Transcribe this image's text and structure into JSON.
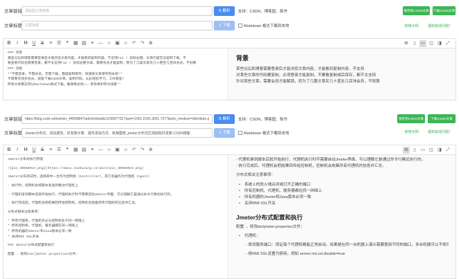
{
  "common": {
    "url_label": "文章链接:",
    "title_label": "文章标题:",
    "parse_button": "⇅ 解析",
    "download_button": "⇩ 下载",
    "support_text": "支持：CSDN、博客园、简书",
    "markdown_text": "Markdown 格式下载到本地",
    "save_csdn": "保存到CSDN文章",
    "download_csdn": "下载CSDN文章",
    "link_example": "使用示例",
    "link_qa": "遇到其他问题？"
  },
  "top": {
    "url_placeholder": "请粘贴文章链接",
    "title_placeholder": "文章标题",
    "source_lines": [
      "### 背景",
      "某些论坛和博客需要登录后才能浏览文章内容，才能看到复制内容。不支持F12 / 鼠标右键，文章内容无法复制下载，不",
      "要查看代码也需要登录，都不太支持F12 / 鼠标右键文章，需要会员才能复制，而为了几篇文章花几十甚至几百块会员，不划算",
      "### 功能",
      "**不需登录，不需会员，无需下载，直接复制保存，快速将文章保存到本地**",
      "不需要花钱买会员，就能下载CSDN文章，复制代码，从此轻松学习，工作摸鱼！",
      "所有文章都支持以Markdown格式下载，确保格式统一，有效保护原文排版**"
    ],
    "preview": {
      "heading": "背景",
      "paragraph_lines": [
        "某些论坛和博客需要登录后才能浏览文章内容，才能看到复制内容，不支持",
        "对某些文章的代码要复制，必须登录才能复制，不要看复制或后保存，都不太支持",
        "针对某些文章，需要会员才能解锁，而为了几篇文章花几十甚至几百块会员，不划算"
      ]
    }
  },
  "bottom": {
    "url_value": "https://blog.csdn.net/weixin_44658847/article/details/129587731?spm=1001.2100.3001.7377&utm_medium=distribute.pc_feed_blog",
    "title_value": "Jmeter分布式、测试报告、并发数计算、插件添加方式、常用图表_jmeter分布式压测获取并发数-CSDN博客",
    "source_lines": [
      "Jmeter分布式执行原理",
      "",
      "![pic_406680ce.png](https://maxu.zuokuoing.cn/pics/pic_406680ce.png)",
      "",
      "Jmeter分布测试时，选择其中一台作为控制机（Controller），其它机器作为代理机（Agent）",
      "",
      "- 执行时，控制机会把脚本发送到每台代理机上",
      "",
      "- 代理机拿到脚本后就开始执行，代理机执行时不需要启动Jmeter界面，可以理解它是通过命令行模式执行的。",
      "",
      "- 执行完成后，代理机会把结果回传给控制机，控制机会收集所有代理机的信息并汇总。",
      "",
      "分布式相关注意事项：",
      "",
      "* 所有代理机，代理机务必与控制机处于同一网络上",
      "* 所有控制机、代理机、服务器都在同一网络上",
      "* 所有机器的Jmeter和Java版本必须一致",
      "* 关闭RMI SSL开关",
      "",
      "### Jmeter分布式配置和执行",
      "",
      "配置 → 修改bin/jmeter.properties文件："
    ],
    "preview": {
      "intro_lines": [
        "- 代理机拿到脚本后就开始执行，代理机执行时不需要启动Jmeter界面，可以理解它是通过命令行模式执行的。",
        "- 执行完成后，代理机会把结果回传给控制机，控制机会收集所有代理机的信息并汇总。"
      ],
      "notes_title": "分布式相关注意事项：",
      "notes": [
        "系统上的防火墙关闭或打开正确的端口",
        "所有控制机、代理机、服务器都在同一网络上",
        "所有机器的Jmeter和Java版本必须一致",
        "关闭RMI SSL开关"
      ],
      "heading": "Jmeter分布式配置和执行",
      "config_line": "配置 → 修改bin/jmeter.properties文件：",
      "agent_label": "代理机：",
      "agent_sub1": "- 修改服务端口：保证每个代理机都能正常启动。如果是在同一台机器上演示需要使用不同的端口，多台机器可以不修改，例如：server_port=1999",
      "agent_sub2": "- 将RMI SSL设置为禁用，例如 server.rmi.ssl.disable=true"
    }
  }
}
